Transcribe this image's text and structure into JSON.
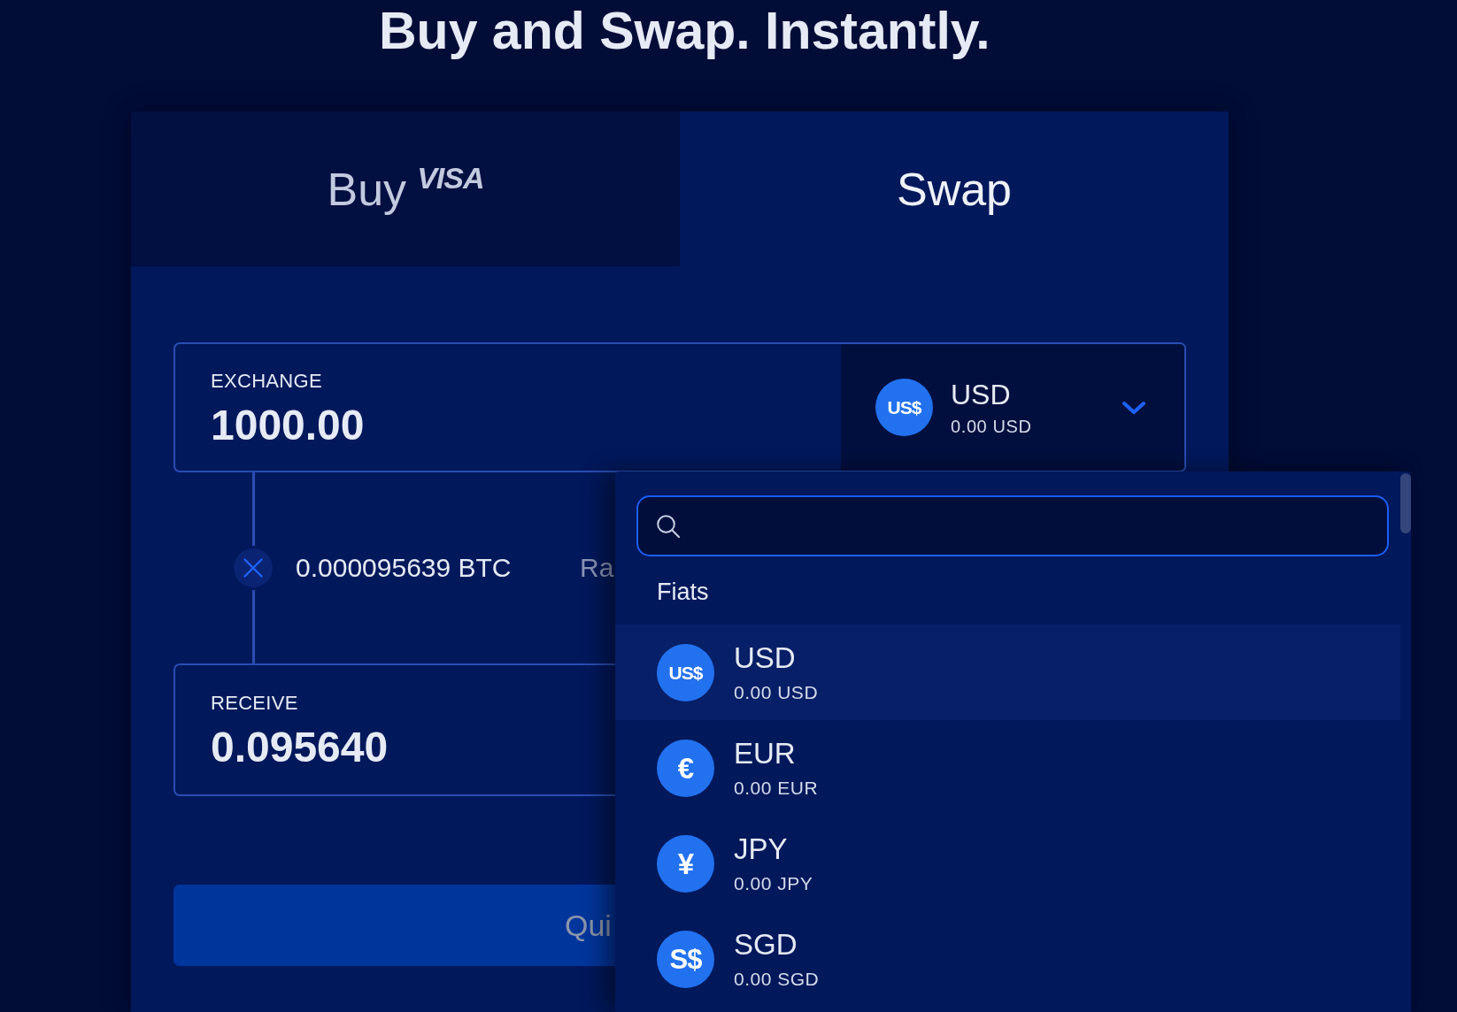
{
  "heading": "Buy and Swap. Instantly.",
  "tabs": [
    {
      "label": "Buy",
      "badge": "VISA",
      "selected": false
    },
    {
      "label": "Swap",
      "selected": true
    }
  ],
  "exchange": {
    "label": "EXCHANGE",
    "amount": "1000.00",
    "currency": {
      "symbol": "US$",
      "code": "USD",
      "balance": "0.00 USD"
    }
  },
  "rate": {
    "amount": "0.000095639 BTC",
    "label": "Ra"
  },
  "receive": {
    "label": "RECEIVE",
    "amount": "0.095640"
  },
  "submit_button": {
    "label": "Qui"
  },
  "currency_menu": {
    "group": "Fiats",
    "items": [
      {
        "symbol": "US$",
        "code": "USD",
        "balance": "0.00 USD",
        "selected": true
      },
      {
        "symbol": "€",
        "code": "EUR",
        "balance": "0.00 EUR",
        "selected": false
      },
      {
        "symbol": "¥",
        "code": "JPY",
        "balance": "0.00 JPY",
        "selected": false
      },
      {
        "symbol": "S$",
        "code": "SGD",
        "balance": "0.00 SGD",
        "selected": false
      }
    ]
  }
}
